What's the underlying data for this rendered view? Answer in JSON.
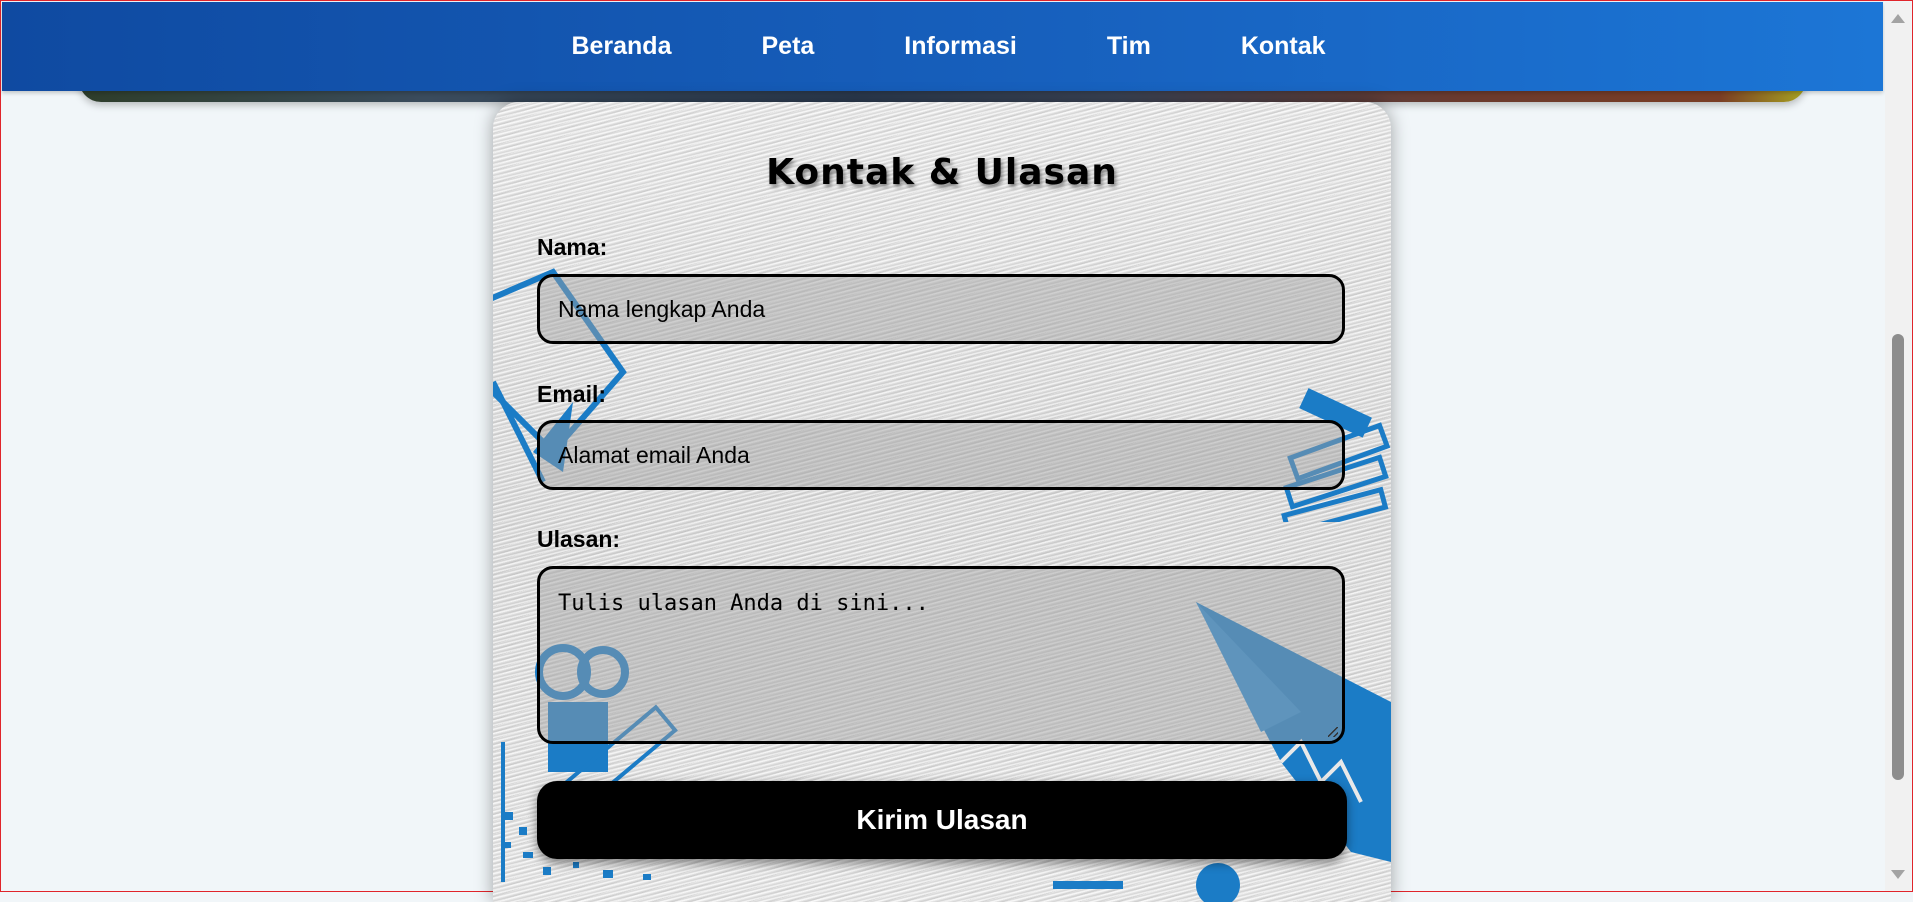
{
  "nav": {
    "items": [
      "Beranda",
      "Peta",
      "Informasi",
      "Tim",
      "Kontak"
    ]
  },
  "form": {
    "title": "Kontak & Ulasan",
    "name_label": "Nama:",
    "name_placeholder": "Nama lengkap Anda",
    "email_label": "Email:",
    "email_placeholder": "Alamat email Anda",
    "review_label": "Ulasan:",
    "review_placeholder": "Tulis ulasan Anda di sini...",
    "submit_label": "Kirim Ulasan"
  },
  "colors": {
    "nav_start": "#0f4aa1",
    "nav_end": "#1c76d6",
    "accent_icon": "#1b7cc6",
    "button": "#000000"
  }
}
